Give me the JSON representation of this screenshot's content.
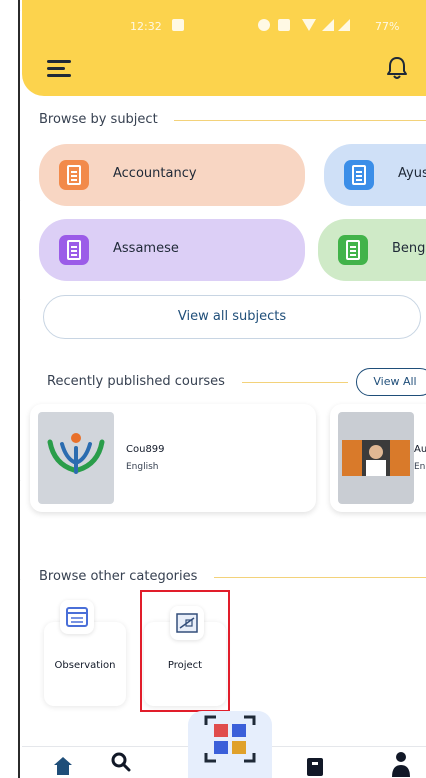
{
  "status_bar": {
    "time": "12:32",
    "battery": "77%"
  },
  "header": {
    "menu_icon": "hamburger-menu-icon",
    "notification_icon": "bell-icon"
  },
  "browse_subject": {
    "title": "Browse by subject",
    "subjects": [
      {
        "label": "Accountancy",
        "bg": "#f8d6c3",
        "icon_bg": "#f28a4a"
      },
      {
        "label": "Ayush",
        "bg": "#cfe0f7",
        "icon_bg": "#3b8ee8"
      },
      {
        "label": "Assamese",
        "bg": "#dccff6",
        "icon_bg": "#9b5ce8"
      },
      {
        "label": "Beng",
        "bg": "#cfeac7",
        "icon_bg": "#42b34a"
      }
    ],
    "view_all_label": "View all subjects"
  },
  "recent_courses": {
    "title": "Recently published courses",
    "view_all_label": "View All",
    "courses": [
      {
        "name": "Cou899",
        "language": "English"
      },
      {
        "name": "Au",
        "language": "En"
      }
    ]
  },
  "other_categories": {
    "title": "Browse other categories",
    "items": [
      {
        "label": "Observation",
        "icon": "observation-form-icon"
      },
      {
        "label": "Project",
        "icon": "project-blueprint-icon"
      }
    ]
  },
  "bottom_nav": {
    "items": [
      "home-icon",
      "search-icon",
      "qr-scan-icon",
      "downloads-icon",
      "profile-icon"
    ],
    "active": "home-icon"
  },
  "colors": {
    "header": "#fcd34d",
    "accent": "#1f4e79",
    "highlight": "#e11d2a"
  }
}
